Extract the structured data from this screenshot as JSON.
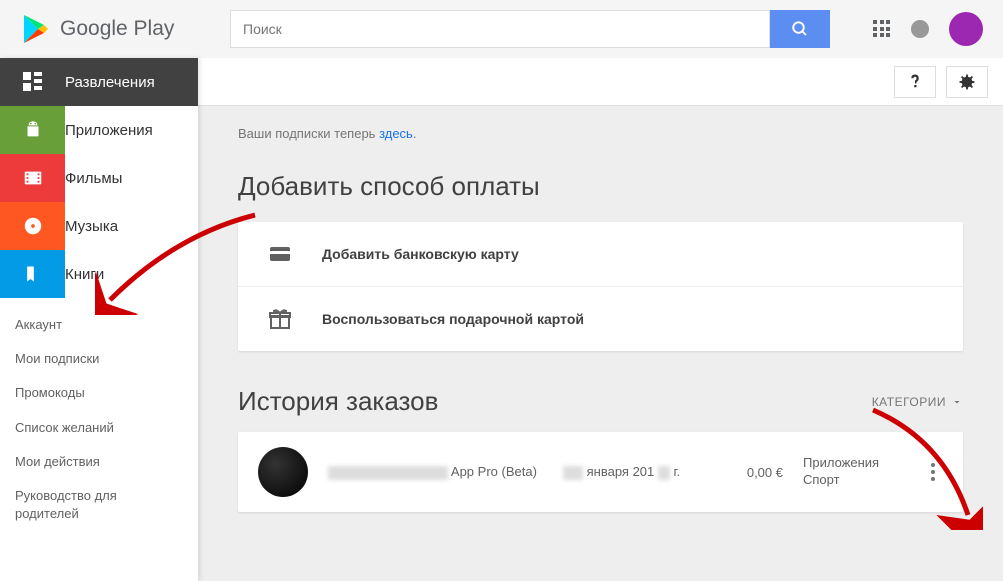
{
  "header": {
    "logo_text": "Google Play",
    "search_placeholder": "Поиск"
  },
  "sidebar": {
    "tiles": [
      {
        "label": "Развлечения"
      },
      {
        "label": "Приложения"
      },
      {
        "label": "Фильмы"
      },
      {
        "label": "Музыка"
      },
      {
        "label": "Книги"
      }
    ],
    "links": [
      {
        "label": "Аккаунт"
      },
      {
        "label": "Мои подписки"
      },
      {
        "label": "Промокоды"
      },
      {
        "label": "Список желаний"
      },
      {
        "label": "Мои действия"
      },
      {
        "label": "Руководство для родителей"
      }
    ]
  },
  "content": {
    "subscriptions_text": "Ваши подписки теперь ",
    "subscriptions_link": "здесь",
    "period": ".",
    "payment_title": "Добавить способ оплаты",
    "add_card": "Добавить банковскую карту",
    "use_gift": "Воспользоваться подарочной картой",
    "history_title": "История заказов",
    "categories_label": "КАТЕГОРИИ",
    "order": {
      "name": "App Pro (Beta)",
      "date_prefix": "января 201",
      "date_suffix": "г.",
      "price": "0,00 €",
      "category_line1": "Приложения",
      "category_line2": "Спорт"
    }
  }
}
